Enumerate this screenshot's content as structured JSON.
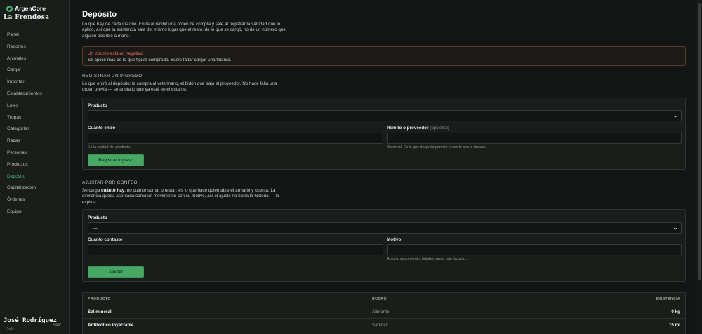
{
  "brand": {
    "name": "ArgenCore",
    "org": "La Frondosa"
  },
  "nav": [
    {
      "label": "Panel",
      "key": "panel"
    },
    {
      "label": "Reportes",
      "key": "reportes"
    },
    {
      "label": "Animales",
      "key": "animales"
    },
    {
      "label": "Cargar",
      "key": "cargar"
    },
    {
      "label": "Importar",
      "key": "importar"
    },
    {
      "label": "Establecimientos",
      "key": "establecimientos"
    },
    {
      "label": "Lotes",
      "key": "lotes"
    },
    {
      "label": "Tropas",
      "key": "tropas"
    },
    {
      "label": "Categorías",
      "key": "categorias"
    },
    {
      "label": "Razas",
      "key": "razas"
    },
    {
      "label": "Personas",
      "key": "personas"
    },
    {
      "label": "Productos",
      "key": "productos"
    },
    {
      "label": "Depósito",
      "key": "deposito"
    },
    {
      "label": "Capitalización",
      "key": "capitalizacion"
    },
    {
      "label": "Órdenes",
      "key": "ordenes"
    },
    {
      "label": "Equipo",
      "key": "equipo"
    }
  ],
  "active_nav": "deposito",
  "user": {
    "name": "José Rodríguez",
    "logout": "Salir",
    "sub": "Salir"
  },
  "page": {
    "title": "Depósito",
    "description": "Lo que hay de cada insumo. Entra al recibir una orden de compra y sale al registrar la sanidad que lo aplicó, así que la existencia sale del mismo lugar que el resto: de lo que se cargó, no de un número que alguien escribió a mano."
  },
  "alert": {
    "title": "Un insumo está en negativo",
    "text": "Se aplicó más de lo que figura comprado. Suele faltar cargar una factura."
  },
  "ingreso": {
    "heading": "REGISTRAR UN INGRESO",
    "description": "Lo que entró al depósito: la compra al veterinario, el bidón que trajo el proveedor. No hace falta una orden previa — se anota lo que ya está en el estante.",
    "producto_label": "Producto",
    "producto_value": "—",
    "cantidad_label": "Cuánto entró",
    "cantidad_value": "",
    "cantidad_help": "En la unidad del producto.",
    "remito_label": "Remito o proveedor",
    "remito_optional": "(opcional)",
    "remito_value": "",
    "remito_help": "Opcional. Es lo que después permite cruzarlo con la factura.",
    "submit": "Registrar ingreso"
  },
  "ajuste": {
    "heading": "AJUSTAR POR CONTEO",
    "desc_pre": "Se carga ",
    "desc_bold": "cuánto hay",
    "desc_post": ", no cuánto sumar o restar: es lo que hace quien abre el armario y cuenta. La diferencia queda asentada como un movimiento con su motivo, así el ajuste no borra la historia — la explica.",
    "producto_label": "Producto",
    "producto_value": "—",
    "conteo_label": "Cuánto contaste",
    "conteo_value": "",
    "motivo_label": "Motivo",
    "motivo_value": "",
    "motivo_help": "Rotura, vencimiento, faltaba cargar una factura...",
    "submit": "Ajustar"
  },
  "table": {
    "headers": {
      "producto": "PRODUCTO",
      "rubro": "RUBRO",
      "existencia": "EXISTENCIA"
    },
    "rows": [
      {
        "producto": "Sal mineral",
        "rubro": "Alimento",
        "existencia": "0 kg"
      },
      {
        "producto": "Antibiótico inyectable",
        "rubro": "Sanidad",
        "existencia": "15 ml"
      }
    ]
  }
}
